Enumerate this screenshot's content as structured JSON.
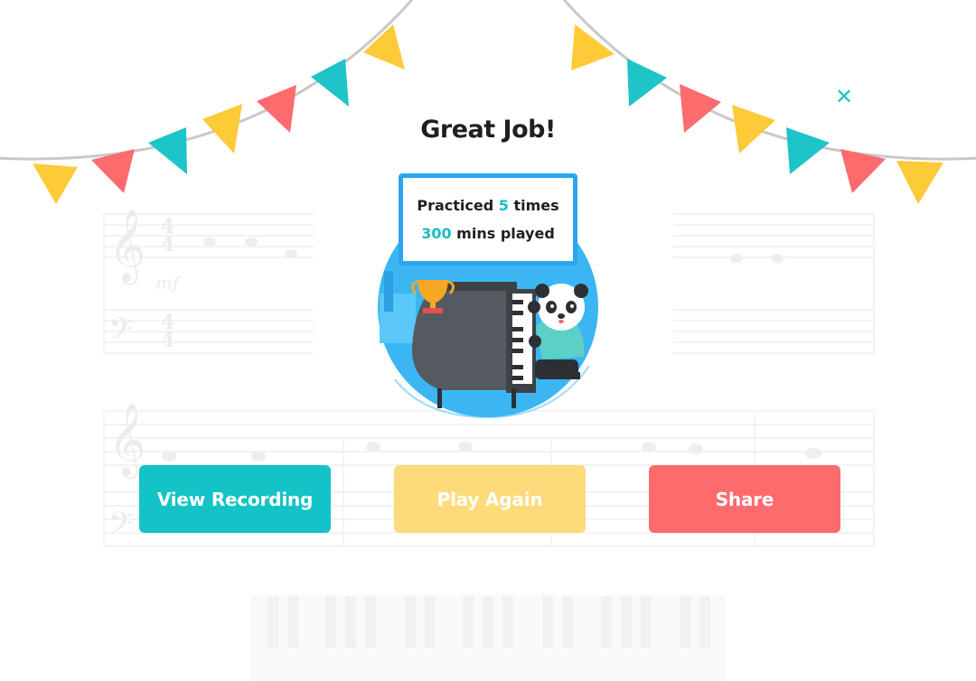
{
  "dialog": {
    "title": "Great Job!",
    "close_symbol": "✕"
  },
  "stats": {
    "practiced_prefix": "Practiced",
    "practiced_count": "5",
    "practiced_suffix": "times",
    "minutes_value": "300",
    "minutes_suffix": "mins played"
  },
  "buttons": {
    "view_recording": "View Recording",
    "play_again": "Play Again",
    "share": "Share"
  },
  "background": {
    "time_signature_top": "4",
    "time_signature_bottom": "4",
    "dynamic_marking": "mf"
  },
  "colors": {
    "teal": "#13c3c6",
    "yellow": "#fdca38",
    "coral": "#fd6b6d",
    "blue": "#2aa6f0"
  }
}
